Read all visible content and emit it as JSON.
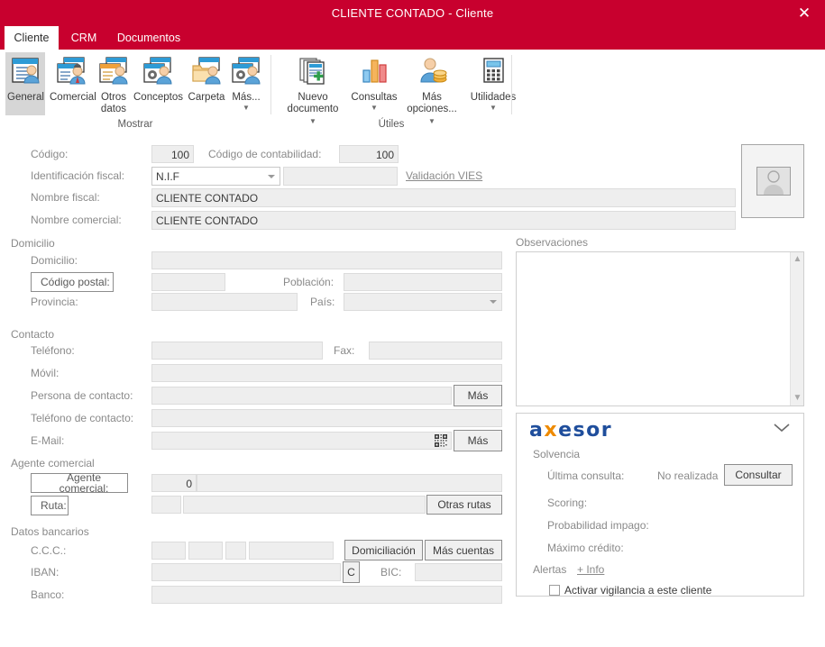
{
  "window": {
    "title": "CLIENTE CONTADO - Cliente",
    "close_label": "✕",
    "accent_color": "#c8002e"
  },
  "tabs": [
    {
      "label": "Cliente",
      "active": true
    },
    {
      "label": "CRM",
      "active": false
    },
    {
      "label": "Documentos",
      "active": false
    }
  ],
  "ribbon": {
    "groups": [
      {
        "label": "Mostrar",
        "buttons": [
          {
            "label": "General",
            "icon": "window-person-icon",
            "selected": true,
            "caret": false
          },
          {
            "label": "Comercial",
            "icon": "window-salesman-icon",
            "selected": false,
            "caret": false
          },
          {
            "label": "Otros datos",
            "icon": "window-list-person-icon",
            "selected": false,
            "caret": false
          },
          {
            "label": "Conceptos",
            "icon": "window-gear-person-icon",
            "selected": false,
            "caret": false
          },
          {
            "label": "Carpeta",
            "icon": "folder-person-icon",
            "selected": false,
            "caret": false
          },
          {
            "label": "Más...",
            "icon": "window-gear-person-icon",
            "selected": false,
            "caret": true
          }
        ]
      },
      {
        "label": "Útiles",
        "buttons": [
          {
            "label": "Nuevo documento",
            "icon": "new-document-icon",
            "selected": false,
            "caret": true
          },
          {
            "label": "Consultas",
            "icon": "bar-chart-icon",
            "selected": false,
            "caret": true
          },
          {
            "label": "Más opciones...",
            "icon": "person-coins-icon",
            "selected": false,
            "caret": true
          },
          {
            "label": "Utilidades",
            "icon": "calculator-icon",
            "selected": false,
            "caret": true
          }
        ]
      }
    ]
  },
  "form": {
    "codigo_label": "Código:",
    "codigo_value": "100",
    "codigo_contabilidad_label": "Código de contabilidad:",
    "codigo_contabilidad_value": "100",
    "identificacion_fiscal_label": "Identificación fiscal:",
    "identificacion_fiscal_value": "N.I.F",
    "identificacion_fiscal_options": [
      "N.I.F"
    ],
    "nif_value": "",
    "validacion_vies_link": "Validación VIES",
    "nombre_fiscal_label": "Nombre fiscal:",
    "nombre_fiscal_value": "CLIENTE CONTADO",
    "nombre_comercial_label": "Nombre comercial:",
    "nombre_comercial_value": "CLIENTE CONTADO",
    "domicilio_group": "Domicilio",
    "domicilio_label": "Domicilio:",
    "domicilio_value": "",
    "codigo_postal_button": "Código postal:",
    "codigo_postal_value": "",
    "poblacion_label": "Población:",
    "poblacion_value": "",
    "provincia_label": "Provincia:",
    "provincia_value": "",
    "pais_label": "País:",
    "pais_value": "",
    "contacto_group": "Contacto",
    "telefono_label": "Teléfono:",
    "telefono_value": "",
    "fax_label": "Fax:",
    "fax_value": "",
    "movil_label": "Móvil:",
    "movil_value": "",
    "persona_contacto_label": "Persona de contacto:",
    "persona_contacto_value": "",
    "persona_contacto_mas": "Más",
    "telefono_contacto_label": "Teléfono de contacto:",
    "telefono_contacto_value": "",
    "email_label": "E-Mail:",
    "email_value": "",
    "email_mas": "Más",
    "email_qr_icon": "qr-code-icon",
    "agente_group": "Agente comercial",
    "agente_button": "Agente comercial:",
    "agente_code_value": "0",
    "agente_name_value": "",
    "ruta_button": "Ruta:",
    "ruta_code_value": "",
    "ruta_name_value": "",
    "otras_rutas_button": "Otras rutas",
    "bancarios_group": "Datos bancarios",
    "ccc_label": "C.C.C.:",
    "ccc_1": "",
    "ccc_2": "",
    "ccc_3": "",
    "ccc_4": "",
    "domiciliacion_button": "Domiciliación",
    "mas_cuentas_button": "Más cuentas",
    "iban_label": "IBAN:",
    "iban_value": "",
    "iban_c_button": "C",
    "bic_label": "BIC:",
    "bic_value": "",
    "banco_label": "Banco:",
    "banco_value": "",
    "photo_icon": "person-placeholder-icon"
  },
  "observaciones": {
    "title": "Observaciones",
    "value": "",
    "scroll_up_icon": "chevron-up-icon",
    "scroll_down_icon": "chevron-down-icon"
  },
  "axesor": {
    "logo_pre": "a",
    "logo_x": "x",
    "logo_post": "esor",
    "collapse_icon": "chevron-down-icon",
    "solvencia_label": "Solvencia",
    "ultima_consulta_label": "Última consulta:",
    "ultima_consulta_value": "No realizada",
    "consultar_button": "Consultar",
    "scoring_label": "Scoring:",
    "scoring_value": "",
    "probabilidad_label": "Probabilidad impago:",
    "probabilidad_value": "",
    "maximo_credito_label": "Máximo crédito:",
    "maximo_credito_value": "",
    "alertas_label": "Alertas",
    "info_link": "+ Info",
    "vigilancia_checkbox_label": "Activar vigilancia a este cliente",
    "vigilancia_checked": false,
    "logo_blue": "#1f4e9c",
    "logo_orange": "#ee8a00"
  }
}
